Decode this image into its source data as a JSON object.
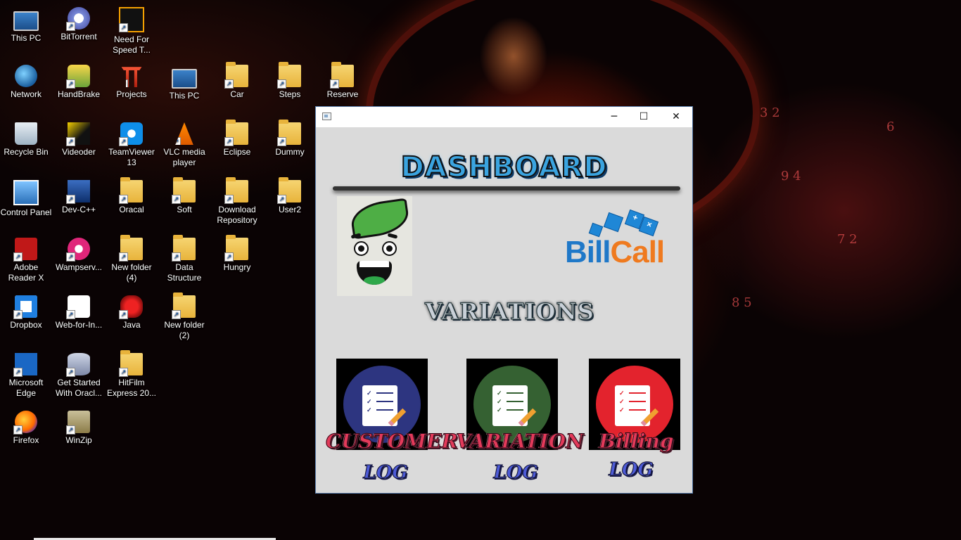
{
  "desktop": {
    "icons": [
      {
        "label": "This PC",
        "icon": "monitor-icon"
      },
      {
        "label": "BitTorrent",
        "icon": "bittorrent-icon"
      },
      {
        "label": "Need For Speed T...",
        "icon": "game-icon"
      },
      {
        "label": "Network",
        "icon": "globe-icon"
      },
      {
        "label": "HandBrake",
        "icon": "handbrake-icon"
      },
      {
        "label": "Projects",
        "icon": "gate-icon"
      },
      {
        "label": "This PC",
        "icon": "monitor-icon"
      },
      {
        "label": "Car",
        "icon": "folder-icon"
      },
      {
        "label": "Steps",
        "icon": "folder-icon"
      },
      {
        "label": "Reserve",
        "icon": "folder-icon"
      },
      {
        "label": "Recycle Bin",
        "icon": "recycle-bin-icon"
      },
      {
        "label": "Videoder",
        "icon": "videoder-icon"
      },
      {
        "label": "TeamViewer 13",
        "icon": "teamviewer-icon"
      },
      {
        "label": "VLC media player",
        "icon": "vlc-icon"
      },
      {
        "label": "Eclipse",
        "icon": "folder-icon"
      },
      {
        "label": "Dummy",
        "icon": "folder-icon"
      },
      {
        "label": "Control Panel",
        "icon": "control-panel-icon"
      },
      {
        "label": "Dev-C++",
        "icon": "devcpp-icon"
      },
      {
        "label": "Oracal",
        "icon": "folder-icon"
      },
      {
        "label": "Soft",
        "icon": "folder-icon"
      },
      {
        "label": "Download Repository",
        "icon": "folder-icon"
      },
      {
        "label": "User2",
        "icon": "folder-icon"
      },
      {
        "label": "Adobe Reader X",
        "icon": "adobe-reader-icon"
      },
      {
        "label": "Wampserv...",
        "icon": "wampserver-icon"
      },
      {
        "label": "New folder (4)",
        "icon": "folder-icon"
      },
      {
        "label": "Data Structure",
        "icon": "folder-icon"
      },
      {
        "label": "Hungry",
        "icon": "folder-icon"
      },
      {
        "label": "Dropbox",
        "icon": "dropbox-icon"
      },
      {
        "label": "Web-for-In...",
        "icon": "web-icon"
      },
      {
        "label": "Java",
        "icon": "java-icon"
      },
      {
        "label": "New folder (2)",
        "icon": "folder-icon"
      },
      {
        "label": "Microsoft Edge",
        "icon": "edge-icon"
      },
      {
        "label": "Get Started With Oracl...",
        "icon": "database-icon"
      },
      {
        "label": "HitFilm Express 20...",
        "icon": "folder-icon"
      },
      {
        "label": "Firefox",
        "icon": "firefox-icon"
      },
      {
        "label": "WinZip",
        "icon": "winzip-icon"
      }
    ]
  },
  "window": {
    "controls": {
      "minimize": "─",
      "maximize": "☐",
      "close": "✕"
    },
    "title_heading": "DASHBOARD",
    "logo_text_bill": "Bill",
    "logo_text_call": "Call",
    "variations_heading": "VARIATIONS",
    "tiles": [
      {
        "caption": "CUSTOMER",
        "sub": "LOG",
        "color": "#2d3580"
      },
      {
        "caption": "VARIATION",
        "sub": "LOG",
        "color": "#356132"
      },
      {
        "caption": "Billing",
        "sub": "LOG",
        "color": "#e3232d"
      }
    ]
  },
  "colors": {
    "window_bg": "#dadada",
    "title_blue": "#3aa4e0",
    "logo_blue": "#1f78c8",
    "logo_orange": "#ef7a1f"
  }
}
